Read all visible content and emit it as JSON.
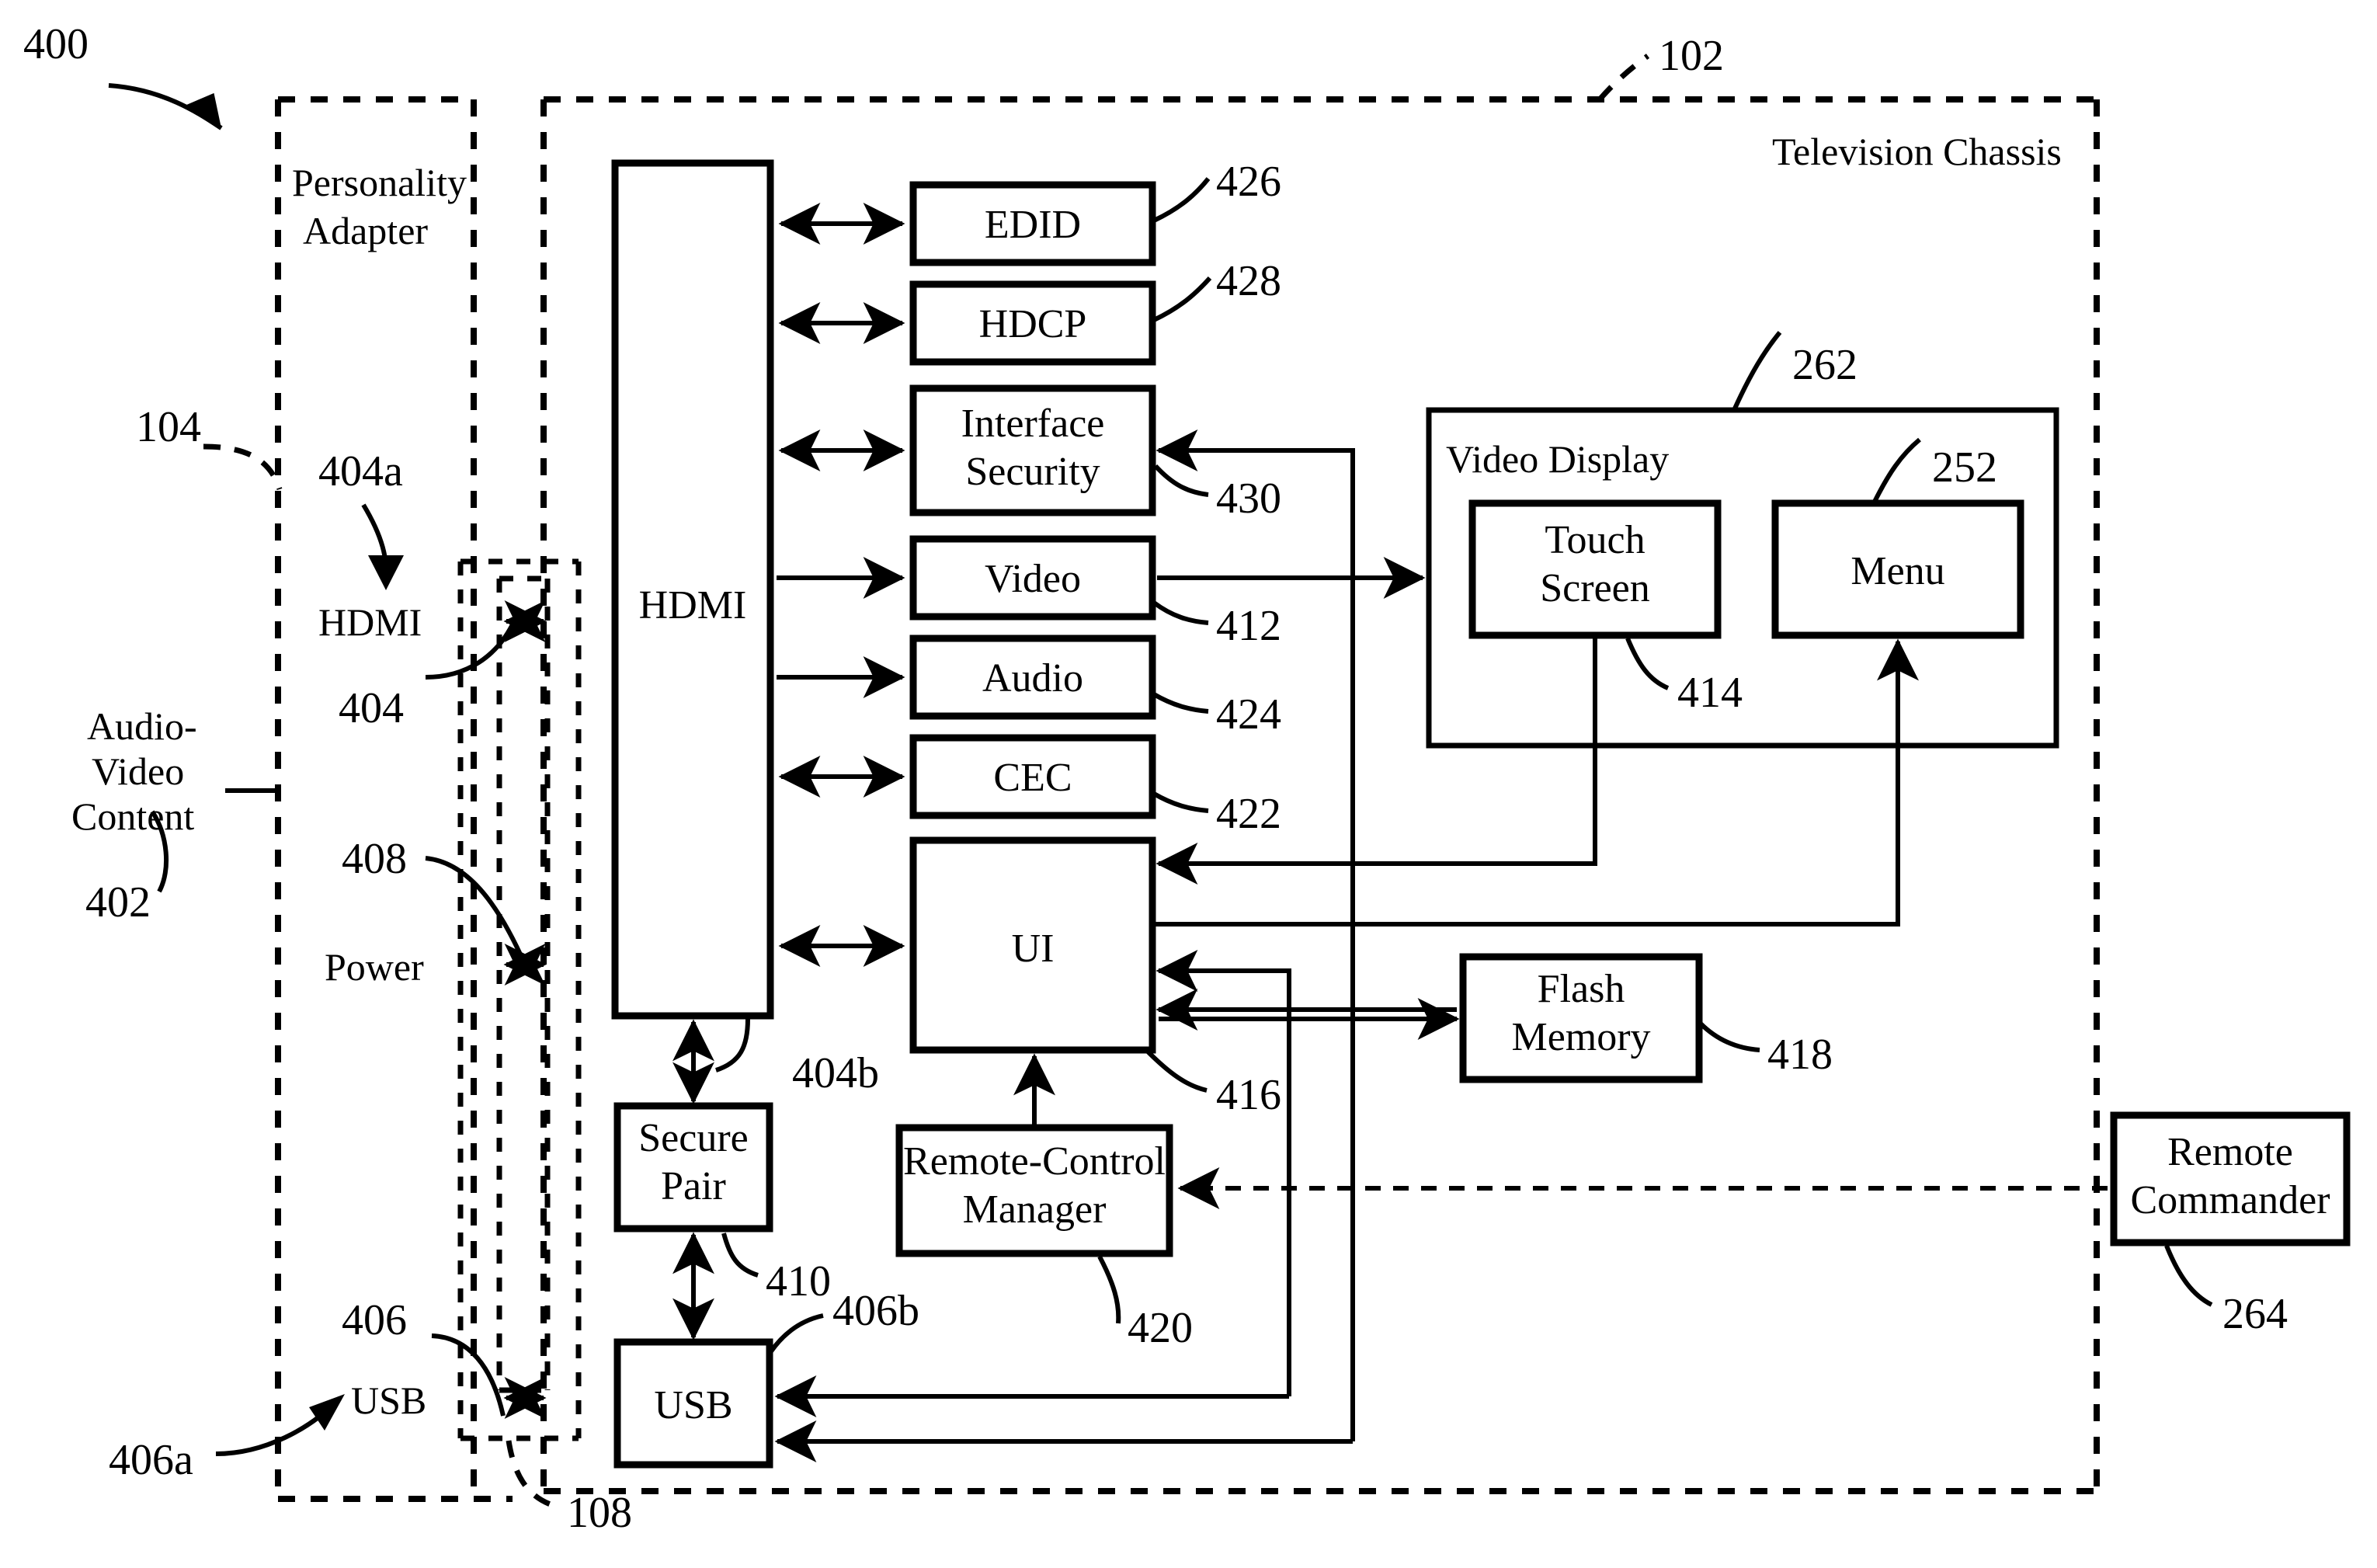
{
  "figure": {
    "id": "400",
    "title": "Television Chassis and Personality Adapter block diagram"
  },
  "regions": {
    "personality_adapter": {
      "label_line1": "Personality",
      "label_line2": "Adapter",
      "ref": "104"
    },
    "television_chassis": {
      "label": "Television Chassis",
      "ref": "102"
    },
    "connector_interface": {
      "ref": "108"
    }
  },
  "left_labels": {
    "av_content": {
      "line1": "Audio-",
      "line2": "Video",
      "line3": "Content",
      "ref": "402"
    },
    "hdmi_port": {
      "label": "HDMI",
      "ref_a": "404a",
      "ref": "404"
    },
    "power_port": {
      "label": "Power",
      "ref": "408"
    },
    "usb_port": {
      "label": "USB",
      "ref": "406",
      "ref_a": "406a"
    }
  },
  "blocks": [
    {
      "key": "hdmi_chassis",
      "label": "HDMI",
      "ref": "404b"
    },
    {
      "key": "edid",
      "label": "EDID",
      "ref": "426"
    },
    {
      "key": "hdcp",
      "label": "HDCP",
      "ref": "428"
    },
    {
      "key": "interface_security",
      "label_line1": "Interface",
      "label_line2": "Security",
      "ref": "430"
    },
    {
      "key": "video",
      "label": "Video",
      "ref": "412"
    },
    {
      "key": "audio",
      "label": "Audio",
      "ref": "424"
    },
    {
      "key": "cec",
      "label": "CEC",
      "ref": "422"
    },
    {
      "key": "ui",
      "label": "UI",
      "ref": "416"
    },
    {
      "key": "secure_pair",
      "label_line1": "Secure",
      "label_line2": "Pair",
      "ref": "410"
    },
    {
      "key": "usb_chassis",
      "label": "USB",
      "ref": "406b"
    },
    {
      "key": "remote_control_manager",
      "label_line1": "Remote-Control",
      "label_line2": "Manager",
      "ref": "420"
    },
    {
      "key": "flash_memory",
      "label_line1": "Flash",
      "label_line2": "Memory",
      "ref": "418"
    },
    {
      "key": "video_display",
      "label": "Video Display",
      "ref": "262"
    },
    {
      "key": "touch_screen",
      "label_line1": "Touch",
      "label_line2": "Screen",
      "ref": "414"
    },
    {
      "key": "menu",
      "label": "Menu",
      "ref": "252"
    },
    {
      "key": "remote_commander",
      "label_line1": "Remote",
      "label_line2": "Commander",
      "ref": "264"
    }
  ],
  "text": {
    "fig_ref_400": "400",
    "fig_ref_104": "104",
    "fig_ref_102": "102",
    "fig_ref_108": "108",
    "fig_ref_402": "402",
    "fig_ref_404": "404",
    "fig_ref_404a": "404a",
    "fig_ref_404b": "404b",
    "fig_ref_406": "406",
    "fig_ref_406a": "406a",
    "fig_ref_406b": "406b",
    "fig_ref_408": "408",
    "fig_ref_410": "410",
    "fig_ref_412": "412",
    "fig_ref_414": "414",
    "fig_ref_416": "416",
    "fig_ref_418": "418",
    "fig_ref_420": "420",
    "fig_ref_422": "422",
    "fig_ref_424": "424",
    "fig_ref_426": "426",
    "fig_ref_428": "428",
    "fig_ref_430": "430",
    "fig_ref_252": "252",
    "fig_ref_262": "262",
    "fig_ref_264": "264",
    "personality_adapter_l1": "Personality",
    "personality_adapter_l2": "Adapter",
    "television_chassis": "Television Chassis",
    "av_l1": "Audio-",
    "av_l2": "Video",
    "av_l3": "Content",
    "hdmi_port": "HDMI",
    "power_port": "Power",
    "usb_port": "USB",
    "hdmi_block": "HDMI",
    "edid": "EDID",
    "hdcp": "HDCP",
    "iface_sec_l1": "Interface",
    "iface_sec_l2": "Security",
    "video": "Video",
    "audio": "Audio",
    "cec": "CEC",
    "ui": "UI",
    "secure_pair_l1": "Secure",
    "secure_pair_l2": "Pair",
    "usb_block": "USB",
    "rcm_l1": "Remote-Control",
    "rcm_l2": "Manager",
    "flash_l1": "Flash",
    "flash_l2": "Memory",
    "video_display": "Video Display",
    "touch_l1": "Touch",
    "touch_l2": "Screen",
    "menu": "Menu",
    "remote_cmdr_l1": "Remote",
    "remote_cmdr_l2": "Commander"
  },
  "colors": {
    "ink": "#000000",
    "paper": "#ffffff"
  }
}
